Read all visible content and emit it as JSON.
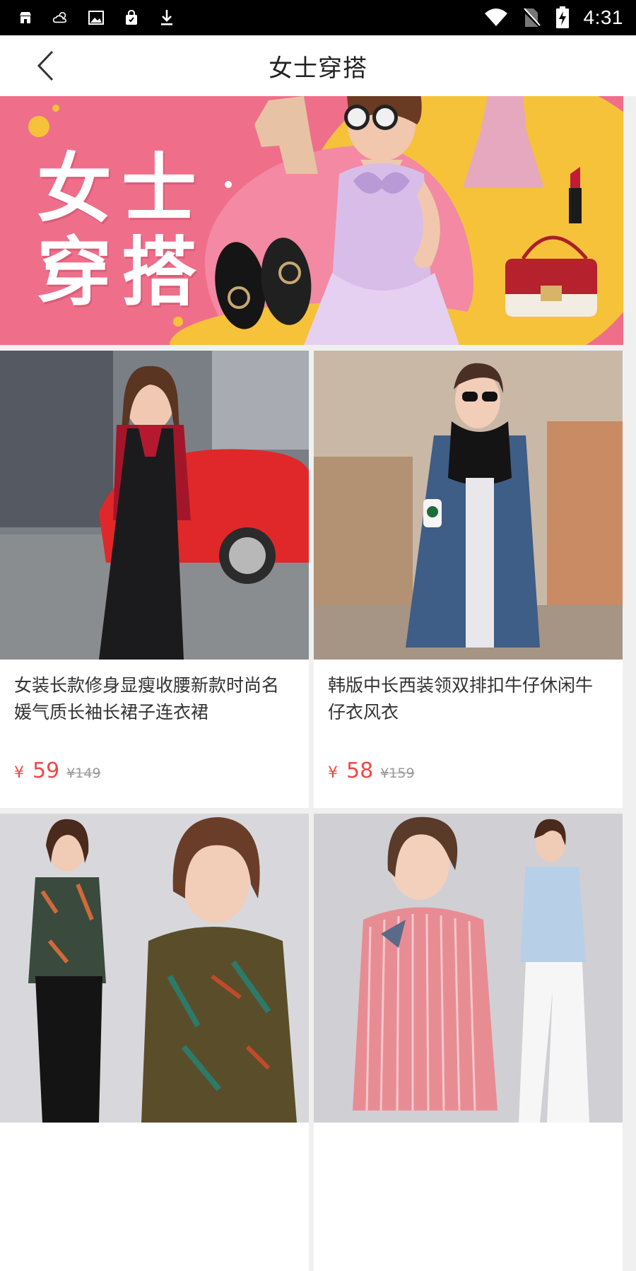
{
  "status_bar": {
    "left_icons": [
      "store-icon",
      "weather-icon",
      "image-icon",
      "shopping-bag-icon",
      "download-icon"
    ],
    "right_icons": [
      "wifi-icon",
      "no-sim-icon",
      "battery-charging-icon"
    ],
    "time": "4:31"
  },
  "header": {
    "title": "女士穿搭"
  },
  "banner": {
    "line1": "女士",
    "line2": "穿搭"
  },
  "products": [
    {
      "name": "女装长款修身显瘦收腰新款时尚名媛气质长袖长裙子连衣裙",
      "currency": "¥",
      "price": "59",
      "original_price": "¥149"
    },
    {
      "name": "韩版中长西装领双排扣牛仔休闲牛仔衣风衣",
      "currency": "¥",
      "price": "58",
      "original_price": "¥159"
    },
    {
      "name": "",
      "currency": "",
      "price": "",
      "original_price": ""
    },
    {
      "name": "",
      "currency": "",
      "price": "",
      "original_price": ""
    }
  ],
  "colors": {
    "price_red": "#f04848",
    "banner_pink": "#ef6f8a",
    "banner_yellow": "#f5c23a"
  }
}
